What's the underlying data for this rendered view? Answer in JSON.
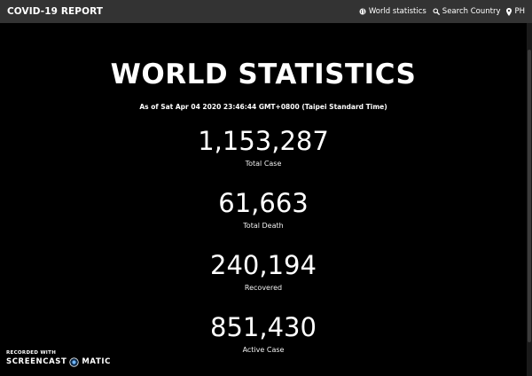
{
  "navbar": {
    "brand": "COVID-19 REPORT",
    "links": [
      {
        "label": "World statistics",
        "icon": "globe-icon"
      },
      {
        "label": "Search Country",
        "icon": "search-icon"
      },
      {
        "label": "PH",
        "icon": "map-marker-icon"
      }
    ]
  },
  "main": {
    "title": "WORLD STATISTICS",
    "as_of": "As of Sat Apr 04 2020 23:46:44 GMT+0800 (Taipei Standard Time)",
    "stats": [
      {
        "value": "1,153,287",
        "label": "Total Case"
      },
      {
        "value": "61,663",
        "label": "Total Death"
      },
      {
        "value": "240,194",
        "label": "Recovered"
      },
      {
        "value": "851,430",
        "label": "Active Case"
      }
    ]
  },
  "watermark": {
    "top_text": "RECORDED WITH",
    "brand_left": "SCREENCAST",
    "brand_right": "MATIC"
  },
  "colors": {
    "background": "#000000",
    "navbar": "#333333",
    "text": "#ffffff"
  }
}
